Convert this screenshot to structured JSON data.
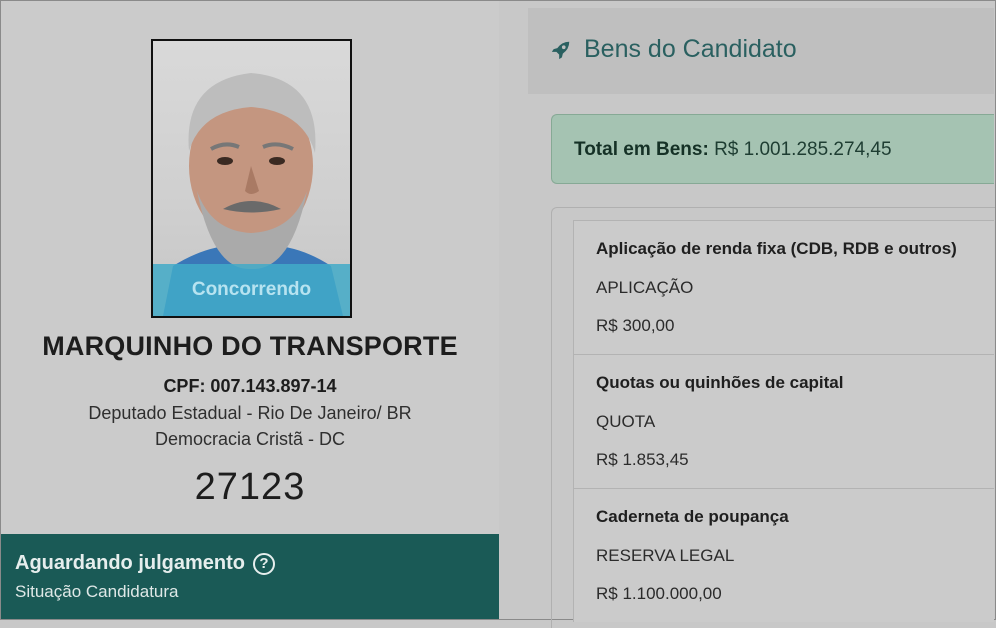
{
  "candidate": {
    "photo_status": "Concorrendo",
    "name": "MARQUINHO DO TRANSPORTE",
    "cpf": "CPF: 007.143.897-14",
    "office": "Deputado Estadual - Rio De Janeiro/ BR",
    "party": "Democracia Cristã - DC",
    "number": "27123"
  },
  "situation": {
    "status": "Aguardando julgamento",
    "label": "Situação Candidatura",
    "help_icon": "?"
  },
  "assets_section": {
    "icon": "rocket-icon",
    "title": "Bens do Candidato",
    "total_label": "Total em Bens:",
    "total_value": "R$ 1.001.285.274,45",
    "items": [
      {
        "type": "Aplicação de renda fixa (CDB, RDB e outros)",
        "description": "APLICAÇÃO",
        "value": "R$ 300,00"
      },
      {
        "type": "Quotas ou quinhões de capital",
        "description": "QUOTA",
        "value": "R$ 1.853,45"
      },
      {
        "type": "Caderneta de poupança",
        "description": "RESERVA LEGAL",
        "value": "R$ 1.100.000,00"
      }
    ]
  },
  "colors": {
    "situation_bg": "#1a5a56",
    "total_bg": "#a5c3b2",
    "status_ribbon": "#42aac8",
    "title_color": "#2a6060"
  }
}
